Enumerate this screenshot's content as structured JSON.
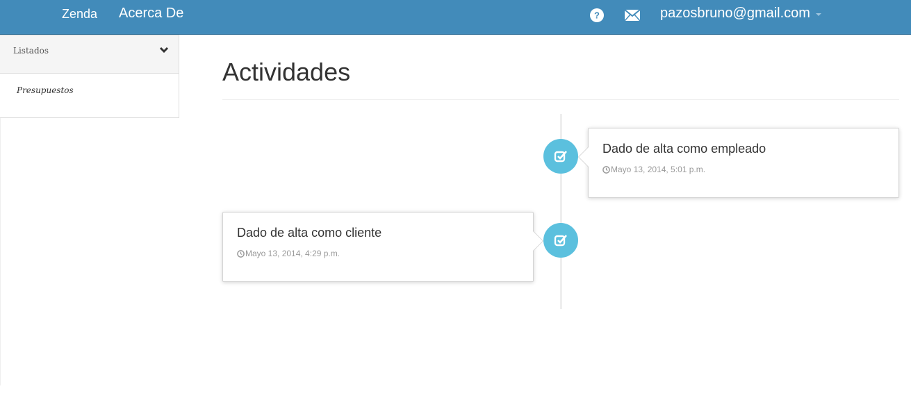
{
  "navbar": {
    "brand": "Zenda",
    "about": "Acerca De",
    "help_icon": "question-circle-icon",
    "mail_icon": "envelope-icon",
    "user_email": "pazosbruno@gmail.com",
    "color": "#428bba"
  },
  "sidebar": {
    "section_label": "Listados",
    "section_icon": "chevron-down-icon",
    "items": [
      {
        "label": "Presupuestos"
      }
    ]
  },
  "main": {
    "title": "Actividades",
    "timeline": [
      {
        "title": "Dado de alta como empleado",
        "time": "Mayo 13, 2014, 5:01 p.m.",
        "side": "right",
        "icon": "check-square-icon"
      },
      {
        "title": "Dado de alta como cliente",
        "time": "Mayo 13, 2014, 4:29 p.m.",
        "side": "left",
        "icon": "check-square-icon"
      }
    ],
    "badge_color": "#5bc0de"
  }
}
